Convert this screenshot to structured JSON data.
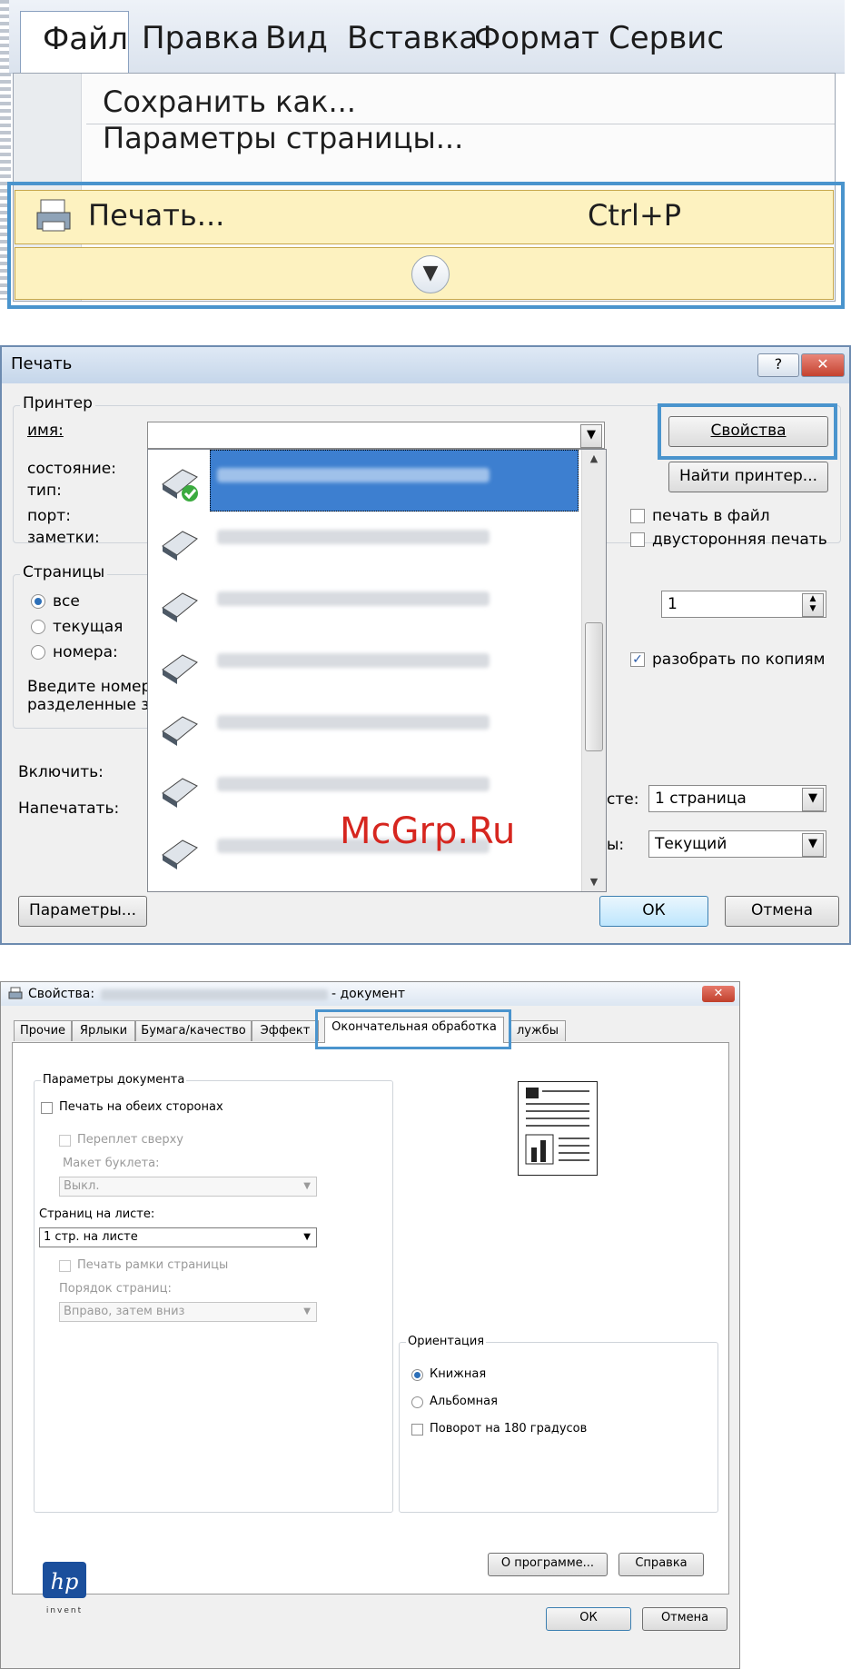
{
  "menu": {
    "menubar": [
      "Файл",
      "Правка",
      "Вид",
      "Вставка",
      "Формат",
      "Сервис"
    ],
    "items": {
      "save_as": "Сохранить как...",
      "page_setup": "Параметры страницы...",
      "print": "Печать...",
      "print_shortcut": "Ctrl+P"
    },
    "expand_glyph": "»"
  },
  "print_dialog": {
    "title": "Печать",
    "help": "?",
    "close": "✕",
    "printer_group": "Принтер",
    "name_label": "имя:",
    "status_label": "состояние:",
    "type_label": "тип:",
    "port_label": "порт:",
    "notes_label": "заметки:",
    "properties_btn": "Свойства",
    "find_printer_btn": "Найти принтер...",
    "print_to_file": "печать в файл",
    "duplex": "двусторонняя печать",
    "pages_group": "Страницы",
    "all": "все",
    "current": "текущая",
    "numbers": "номера:",
    "hint1": "Введите номер",
    "hint2": "разделенные з",
    "copies_value": "1",
    "collate": "разобрать по копиям",
    "include_label": "Включить:",
    "print_label": "Напечатать:",
    "per_sheet_label_tail": "сте:",
    "per_sheet_value": "1 страница",
    "scale_label_tail": "ы:",
    "scale_value": "Текущий",
    "options_btn": "Параметры...",
    "ok_btn": "ОК",
    "cancel_btn": "Отмена",
    "watermark": "McGrp.Ru"
  },
  "props_dialog": {
    "title_prefix": "Свойства:",
    "title_suffix": "- документ",
    "close": "✕",
    "tabs": [
      "Прочие",
      "Ярлыки",
      "Бумага/качество",
      "Эффект",
      "Окончательная обработка",
      "лужбы"
    ],
    "doc_group": "Параметры документа",
    "duplex": "Печать на обеих сторонах",
    "binding_top": "Переплет сверху",
    "booklet_label": "Макет буклета:",
    "booklet_value": "Выкл.",
    "pages_per_sheet_label": "Страниц на листе:",
    "pages_per_sheet_value": "1 стр. на листе",
    "print_borders": "Печать рамки страницы",
    "page_order_label": "Порядок страниц:",
    "page_order_value": "Вправо, затем вниз",
    "orientation_group": "Ориентация",
    "portrait": "Книжная",
    "landscape": "Альбомная",
    "rotate": "Поворот на 180 градусов",
    "about_btn": "О программе...",
    "help_btn": "Справка",
    "ok_btn": "ОК",
    "cancel_btn": "Отмена",
    "logo_text": "hp",
    "logo_sub": "invent"
  },
  "colors": {
    "highlight": "#4a94cd",
    "selection": "#3d7fd0",
    "menu_hover": "#fdf2c0"
  }
}
